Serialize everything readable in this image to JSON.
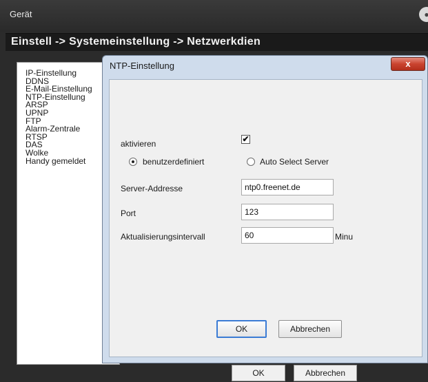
{
  "window": {
    "title": "Gerät",
    "breadcrumb": "Einstell -> Systemeinstellung -> Netzwerkdien"
  },
  "sidebar": {
    "items": [
      {
        "label": "IP-Einstellung"
      },
      {
        "label": "DDNS"
      },
      {
        "label": "E-Mail-Einstellung"
      },
      {
        "label": "NTP-Einstellung"
      },
      {
        "label": "ARSP"
      },
      {
        "label": "UPNP"
      },
      {
        "label": "FTP"
      },
      {
        "label": "Alarm-Zentrale"
      },
      {
        "label": "RTSP"
      },
      {
        "label": "DAS"
      },
      {
        "label": "Wolke"
      },
      {
        "label": "Handy gemeldet"
      }
    ]
  },
  "outer_buttons": {
    "ok": "OK",
    "cancel": "Abbrechen"
  },
  "dialog": {
    "title": "NTP-Einstellung",
    "close_glyph": "x",
    "enable": {
      "label": "aktivieren",
      "checked": true,
      "check_glyph": "✔"
    },
    "mode": {
      "custom_label": "benutzerdefiniert",
      "auto_label": "Auto Select Server",
      "selected": "custom"
    },
    "server": {
      "label": "Server-Addresse",
      "value": "ntp0.freenet.de"
    },
    "port": {
      "label": "Port",
      "value": "123"
    },
    "interval": {
      "label": "Aktualisierungsintervall",
      "value": "60",
      "unit": "Minu"
    },
    "ok_label": "OK",
    "cancel_label": "Abbrechen"
  }
}
